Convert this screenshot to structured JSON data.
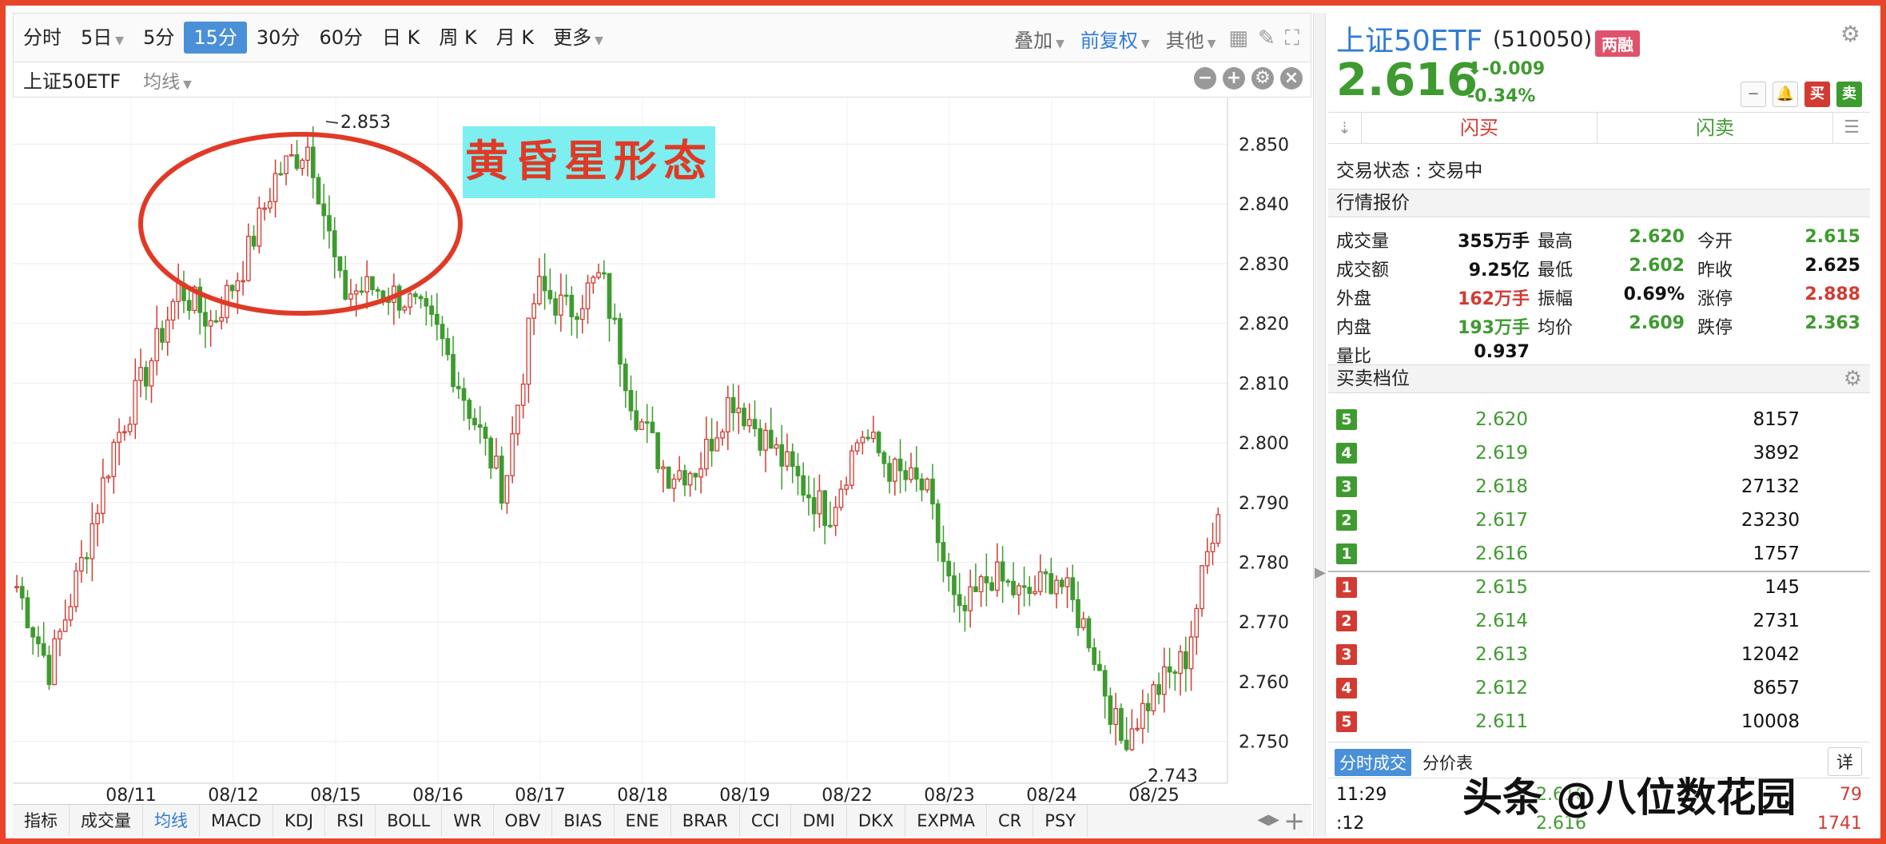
{
  "toolbar": {
    "periods": [
      "分时",
      "5日",
      "5分",
      "15分",
      "30分",
      "60分",
      "日 K",
      "周 K",
      "月 K",
      "更多"
    ],
    "active_period": "15分",
    "overlay": "叠加",
    "adjust": "前复权",
    "other": "其他"
  },
  "subheader": {
    "stock_name": "上证50ETF",
    "indicator": "均线"
  },
  "annotation": {
    "label": "黄昏星形态"
  },
  "chart_data": {
    "type": "candlestick",
    "interval": "15分",
    "ylim": [
      2.743,
      2.853
    ],
    "yticks": [
      "2.850",
      "2.840",
      "2.830",
      "2.820",
      "2.810",
      "2.800",
      "2.790",
      "2.780",
      "2.770",
      "2.760",
      "2.750"
    ],
    "xticks": [
      "08/11",
      "08/12",
      "08/15",
      "08/16",
      "08/17",
      "08/18",
      "08/19",
      "08/22",
      "08/23",
      "08/24",
      "08/25"
    ],
    "high_label": "2.853",
    "low_label": "2.743",
    "keypoints": [
      {
        "date": "08/10",
        "close": 2.776
      },
      {
        "date": "08/10",
        "close": 2.762
      },
      {
        "date": "08/11",
        "close": 2.78
      },
      {
        "date": "08/11",
        "close": 2.8
      },
      {
        "date": "08/11",
        "close": 2.812
      },
      {
        "date": "08/12",
        "close": 2.826
      },
      {
        "date": "08/12",
        "close": 2.82
      },
      {
        "date": "08/12",
        "close": 2.83
      },
      {
        "date": "08/12",
        "close": 2.845
      },
      {
        "date": "08/15",
        "close": 2.85
      },
      {
        "date": "08/15",
        "close": 2.825
      },
      {
        "date": "08/15",
        "close": 2.826
      },
      {
        "date": "08/16",
        "close": 2.824
      },
      {
        "date": "08/16",
        "close": 2.818
      },
      {
        "date": "08/16",
        "close": 2.805
      },
      {
        "date": "08/17",
        "close": 2.792
      },
      {
        "date": "08/17",
        "close": 2.826
      },
      {
        "date": "08/17",
        "close": 2.822
      },
      {
        "date": "08/17",
        "close": 2.828
      },
      {
        "date": "08/18",
        "close": 2.806
      },
      {
        "date": "08/18",
        "close": 2.795
      },
      {
        "date": "08/18",
        "close": 2.796
      },
      {
        "date": "08/19",
        "close": 2.808
      },
      {
        "date": "08/19",
        "close": 2.801
      },
      {
        "date": "08/19",
        "close": 2.794
      },
      {
        "date": "08/22",
        "close": 2.788
      },
      {
        "date": "08/22",
        "close": 2.802
      },
      {
        "date": "08/22",
        "close": 2.795
      },
      {
        "date": "08/22",
        "close": 2.792
      },
      {
        "date": "08/23",
        "close": 2.77
      },
      {
        "date": "08/23",
        "close": 2.778
      },
      {
        "date": "08/23",
        "close": 2.774
      },
      {
        "date": "08/24",
        "close": 2.778
      },
      {
        "date": "08/24",
        "close": 2.768
      },
      {
        "date": "08/24",
        "close": 2.75
      },
      {
        "date": "08/25",
        "close": 2.758
      },
      {
        "date": "08/25",
        "close": 2.764
      },
      {
        "date": "08/25",
        "close": 2.79
      }
    ]
  },
  "bottom_tabs": [
    "指标",
    "成交量",
    "均线",
    "MACD",
    "KDJ",
    "RSI",
    "BOLL",
    "WR",
    "OBV",
    "BIAS",
    "ENE",
    "BRAR",
    "CCI",
    "DMI",
    "DKX",
    "EXPMA",
    "CR",
    "PSY"
  ],
  "active_bottom_tab": "均线",
  "panel": {
    "name": "上证50ETF",
    "code": "(510050)",
    "badge": "两融",
    "price": "2.616",
    "change": "-0.009",
    "change_pct": "-0.34%",
    "buy_btn": "买",
    "sell_btn": "卖",
    "flash_buy": "闪买",
    "flash_sell": "闪卖",
    "trade_state": "交易状态 : 交易中",
    "quote_title": "行情报价",
    "quote": {
      "volume_label": "成交量",
      "volume": "355万手",
      "high_label": "最高",
      "high": "2.620",
      "open_label": "今开",
      "open": "2.615",
      "amount_label": "成交额",
      "amount": "9.25亿",
      "low_label": "最低",
      "low": "2.602",
      "prev_label": "昨收",
      "prev": "2.625",
      "outer_label": "外盘",
      "outer": "162万手",
      "amp_label": "振幅",
      "amp": "0.69%",
      "limitup_label": "涨停",
      "limitup": "2.888",
      "inner_label": "内盘",
      "inner": "193万手",
      "avg_label": "均价",
      "avg": "2.609",
      "limitdown_label": "跌停",
      "limitdown": "2.363",
      "ratio_label": "量比",
      "ratio": "0.937"
    },
    "orderbook_title": "买卖档位",
    "asks": [
      {
        "level": "5",
        "price": "2.620",
        "vol": "8157"
      },
      {
        "level": "4",
        "price": "2.619",
        "vol": "3892"
      },
      {
        "level": "3",
        "price": "2.618",
        "vol": "27132"
      },
      {
        "level": "2",
        "price": "2.617",
        "vol": "23230"
      },
      {
        "level": "1",
        "price": "2.616",
        "vol": "1757"
      }
    ],
    "bids": [
      {
        "level": "1",
        "price": "2.615",
        "vol": "145"
      },
      {
        "level": "2",
        "price": "2.614",
        "vol": "2731"
      },
      {
        "level": "3",
        "price": "2.613",
        "vol": "12042"
      },
      {
        "level": "4",
        "price": "2.612",
        "vol": "8657"
      },
      {
        "level": "5",
        "price": "2.611",
        "vol": "10008"
      }
    ],
    "tick_tab_active": "分时成交",
    "tick_tab_other": "分价表",
    "tick_detail": "详",
    "ticks": [
      {
        "time": "11:29",
        "price": "2.616",
        "vol": "79"
      },
      {
        "time": ":12",
        "price": "2.616",
        "vol": "1741"
      }
    ]
  },
  "watermark": "头条 @八位数花园",
  "colors": {
    "up": "#d23b32",
    "down": "#3e9b2f",
    "accent": "#2f7bd6",
    "frame": "#e8452b"
  }
}
